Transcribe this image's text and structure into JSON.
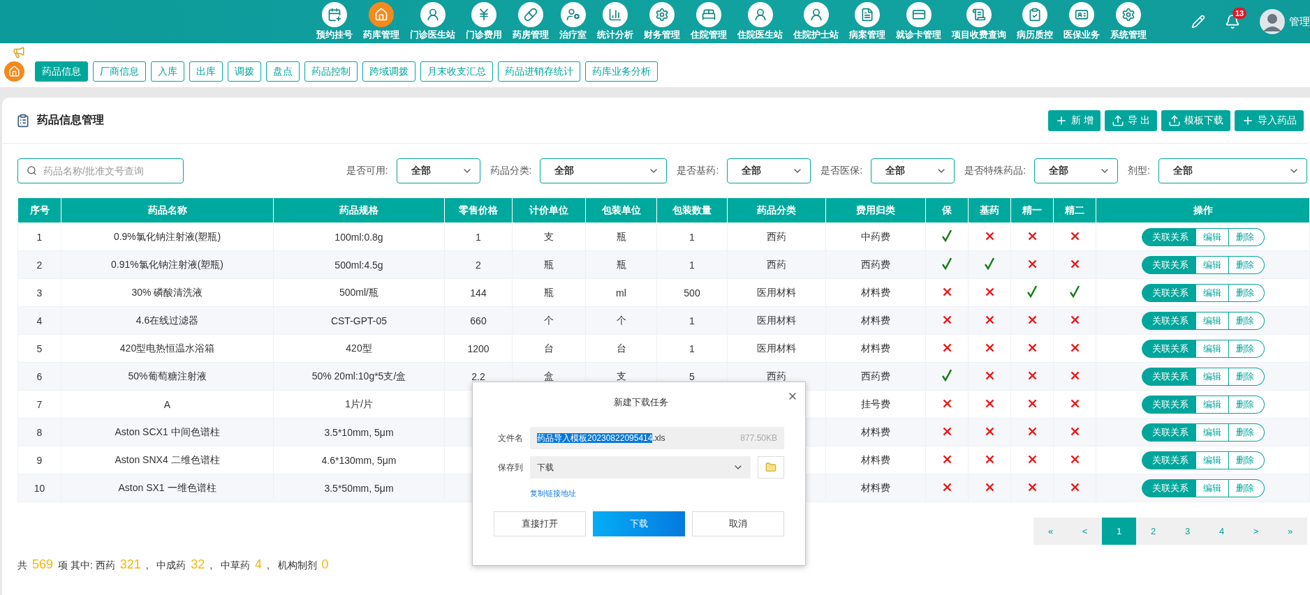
{
  "nav": {
    "items": [
      {
        "label": "预约挂号",
        "selected": false
      },
      {
        "label": "药库管理",
        "selected": true
      },
      {
        "label": "门诊医生站",
        "selected": false
      },
      {
        "label": "门诊费用",
        "selected": false
      },
      {
        "label": "药房管理",
        "selected": false
      },
      {
        "label": "治疗室",
        "selected": false
      },
      {
        "label": "统计分析",
        "selected": false
      },
      {
        "label": "财务管理",
        "selected": false
      },
      {
        "label": "住院管理",
        "selected": false
      },
      {
        "label": "住院医生站",
        "selected": false
      },
      {
        "label": "住院护士站",
        "selected": false
      },
      {
        "label": "病案管理",
        "selected": false
      },
      {
        "label": "就诊卡管理",
        "selected": false
      },
      {
        "label": "项目收费查询",
        "selected": false
      },
      {
        "label": "病历质控",
        "selected": false
      },
      {
        "label": "医保业务",
        "selected": false
      },
      {
        "label": "系统管理",
        "selected": false
      }
    ],
    "notification_count": "13",
    "user_name": "管理"
  },
  "tabs": [
    {
      "label": "药品信息",
      "selected": true
    },
    {
      "label": "厂商信息",
      "selected": false
    },
    {
      "label": "入库",
      "selected": false
    },
    {
      "label": "出库",
      "selected": false
    },
    {
      "label": "调拨",
      "selected": false
    },
    {
      "label": "盘点",
      "selected": false
    },
    {
      "label": "药品控制",
      "selected": false
    },
    {
      "label": "跨域调拨",
      "selected": false
    },
    {
      "label": "月末收支汇总",
      "selected": false
    },
    {
      "label": "药品进销存统计",
      "selected": false
    },
    {
      "label": "药库业务分析",
      "selected": false
    }
  ],
  "panel": {
    "title": "药品信息管理",
    "buttons": [
      {
        "kind": "add",
        "label": "新 增"
      },
      {
        "kind": "export",
        "label": "导 出"
      },
      {
        "kind": "export",
        "label": "模板下载"
      },
      {
        "kind": "add",
        "label": "导入药品"
      }
    ],
    "search": {
      "placeholder": "药品名称/批准文号查询"
    },
    "filters": [
      {
        "label": "是否可用:",
        "value": "全部"
      },
      {
        "label": "药品分类:",
        "value": "全部"
      },
      {
        "label": "是否基药:",
        "value": "全部"
      },
      {
        "label": "是否医保:",
        "value": "全部"
      },
      {
        "label": "是否特殊药品:",
        "value": "全部"
      },
      {
        "label": "剂型:",
        "value": "全部"
      }
    ]
  },
  "table": {
    "columns": [
      "序号",
      "药品名称",
      "药品规格",
      "零售价格",
      "计价单位",
      "包装单位",
      "包装数量",
      "药品分类",
      "费用归类",
      "保",
      "基药",
      "精一",
      "精二",
      "操作"
    ],
    "rows": [
      {
        "no": "1",
        "name": "0.9%氯化钠注射液(塑瓶)",
        "spec": "100ml:0.8g",
        "price": "1",
        "unit": "支",
        "pack_unit": "瓶",
        "pack_qty": "1",
        "category": "西药",
        "fee": "中药费",
        "flags": [
          true,
          false,
          false,
          false
        ],
        "actions": [
          "关联关系",
          "编辑",
          "删除"
        ]
      },
      {
        "no": "2",
        "name": "0.91%氯化钠注射液(塑瓶)",
        "spec": "500ml:4.5g",
        "price": "2",
        "unit": "瓶",
        "pack_unit": "瓶",
        "pack_qty": "1",
        "category": "西药",
        "fee": "西药费",
        "flags": [
          true,
          true,
          false,
          false
        ],
        "actions": [
          "关联关系",
          "编辑",
          "删除"
        ]
      },
      {
        "no": "3",
        "name": "30% 磷酸清洗液",
        "spec": "500ml/瓶",
        "price": "144",
        "unit": "瓶",
        "pack_unit": "ml",
        "pack_qty": "500",
        "category": "医用材料",
        "fee": "材料费",
        "flags": [
          false,
          false,
          true,
          true
        ],
        "actions": [
          "关联关系",
          "编辑",
          "删除"
        ]
      },
      {
        "no": "4",
        "name": "4.6在线过滤器",
        "spec": "CST-GPT-05",
        "price": "660",
        "unit": "个",
        "pack_unit": "个",
        "pack_qty": "1",
        "category": "医用材料",
        "fee": "材料费",
        "flags": [
          false,
          false,
          false,
          false
        ],
        "actions": [
          "关联关系",
          "编辑",
          "删除"
        ]
      },
      {
        "no": "5",
        "name": "420型电热恒温水浴箱",
        "spec": "420型",
        "price": "1200",
        "unit": "台",
        "pack_unit": "台",
        "pack_qty": "1",
        "category": "医用材料",
        "fee": "材料费",
        "flags": [
          false,
          false,
          false,
          false
        ],
        "actions": [
          "关联关系",
          "编辑",
          "删除"
        ]
      },
      {
        "no": "6",
        "name": "50%葡萄糖注射液",
        "spec": "50% 20ml:10g*5支/盒",
        "price": "2.2",
        "unit": "盒",
        "pack_unit": "支",
        "pack_qty": "5",
        "category": "西药",
        "fee": "西药费",
        "flags": [
          true,
          false,
          false,
          false
        ],
        "actions": [
          "关联关系",
          "编辑",
          "删除"
        ]
      },
      {
        "no": "7",
        "name": "A",
        "spec": "1片/片",
        "price": null,
        "unit": null,
        "pack_unit": null,
        "pack_qty": null,
        "category": null,
        "fee": "挂号费",
        "flags": [
          false,
          false,
          false,
          false
        ],
        "actions": [
          "关联关系",
          "编辑",
          "删除"
        ]
      },
      {
        "no": "8",
        "name": "Aston SCX1 中间色谱柱",
        "spec": "3.5*10mm, 5μm",
        "price": null,
        "unit": null,
        "pack_unit": null,
        "pack_qty": null,
        "category": null,
        "fee": "材料费",
        "flags": [
          false,
          false,
          false,
          false
        ],
        "actions": [
          "关联关系",
          "编辑",
          "删除"
        ]
      },
      {
        "no": "9",
        "name": "Aston SNX4 二维色谱柱",
        "spec": "4.6*130mm, 5μm",
        "price": null,
        "unit": null,
        "pack_unit": null,
        "pack_qty": null,
        "category": null,
        "fee": "材料费",
        "flags": [
          false,
          false,
          false,
          false
        ],
        "actions": [
          "关联关系",
          "编辑",
          "删除"
        ]
      },
      {
        "no": "10",
        "name": "Aston SX1 一维色谱柱",
        "spec": "3.5*50mm, 5μm",
        "price": null,
        "unit": null,
        "pack_unit": null,
        "pack_qty": null,
        "category": null,
        "fee": "材料费",
        "flags": [
          false,
          false,
          false,
          false
        ],
        "actions": [
          "关联关系",
          "编辑",
          "删除"
        ]
      }
    ]
  },
  "pagination": [
    {
      "label": "«",
      "selected": false
    },
    {
      "label": "<",
      "selected": false
    },
    {
      "label": "1",
      "selected": true
    },
    {
      "label": "2",
      "selected": false
    },
    {
      "label": "3",
      "selected": false
    },
    {
      "label": "4",
      "selected": false
    },
    {
      "label": ">",
      "selected": false
    },
    {
      "label": "»",
      "selected": false
    }
  ],
  "summary": {
    "prefix": "共",
    "total": "569",
    "middle": "项 其中:",
    "items": [
      {
        "name": "西药",
        "count": "321",
        "separator": ","
      },
      {
        "name": "中成药",
        "count": "32",
        "separator": ","
      },
      {
        "name": "中草药",
        "count": "4",
        "separator": ","
      },
      {
        "name": "机构制剂",
        "count": "0"
      }
    ]
  },
  "dialog": {
    "title": "新建下载任务",
    "file_label": "文件名",
    "file_name_selected": "药品导入模板20230822095414",
    "file_name_rest": ".xls",
    "file_size": "877.50KB",
    "save_label": "保存到",
    "save_to": "下载",
    "copy_link": "复制链接地址",
    "buttons": [
      {
        "kind": "plain",
        "label": "直接打开"
      },
      {
        "kind": "primary",
        "label": "下载"
      },
      {
        "kind": "plain",
        "label": "取消"
      }
    ]
  }
}
